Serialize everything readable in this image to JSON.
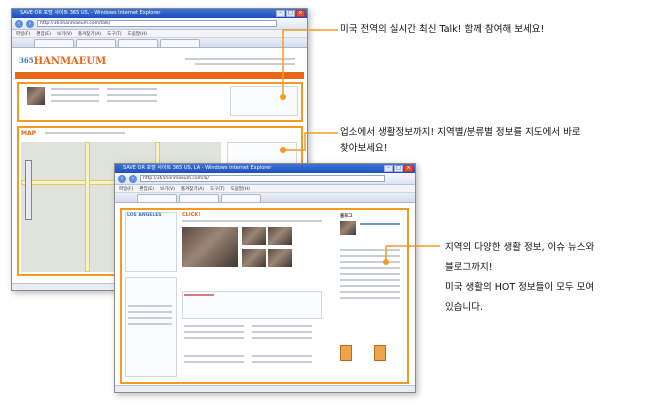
{
  "window1": {
    "title": "SAVE OR 포털 사이트 365 US, - Windows Internet Explorer",
    "address": "http://365hanmaeum.com/talk/",
    "menu": [
      "파일(F)",
      "편집(E)",
      "보기(V)",
      "즐겨찾기(A)",
      "도구(T)",
      "도움말(H)"
    ],
    "site_logo": "365",
    "site_logo_accent": "HANMAEUM",
    "map_tab": "MAP"
  },
  "window2": {
    "title": "SAVE OR 포털 사이트 365 US, LA - Windows Internet Explorer",
    "address": "http://365hanmaeum.com/la/",
    "menu": [
      "파일(F)",
      "편집(E)",
      "보기(V)",
      "즐겨찾기(A)",
      "도구(T)",
      "도움말(H)"
    ],
    "site_section": "LOS ANGELES",
    "click_label": "CLICK!",
    "blog_label": "블로그"
  },
  "callouts": {
    "top": "미국 전역의 실시간 최신 Talk! 함께 참여해 보세요!",
    "middle_1": "업소에서 생활정보까지! 지역별/분류별 정보를 지도에서 바로",
    "middle_2": "찾아보세요!",
    "bottom_1": "지역의 다양한 생활 정보, 이슈 뉴스와",
    "bottom_2": "블로그까지!",
    "bottom_3": "미국 생활의 HOT 정보들이 모두 모여",
    "bottom_4": "있습니다."
  },
  "colors": {
    "accent": "#f39a23",
    "ie_title": "#2a5fc7",
    "site_orange": "#e8671b"
  }
}
